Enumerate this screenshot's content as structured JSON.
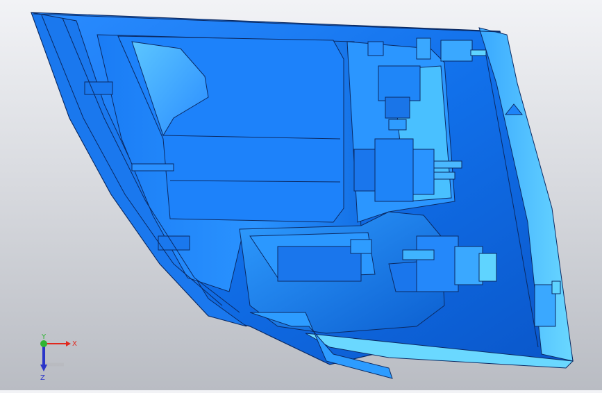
{
  "viewport": {
    "model": "headlamp-assembly"
  },
  "triad": {
    "x_label": "X",
    "y_label": "Y",
    "z_label": "Z",
    "colors": {
      "x": "#e0281e",
      "y": "#2fb533",
      "z": "#2a35c9"
    }
  },
  "colors": {
    "model_dark": "#0b5fd6",
    "model_mid": "#1e88ff",
    "model_light": "#3fb4ff",
    "model_cyan": "#5fd4ff",
    "edge": "#0b2a63",
    "background_top": "#f2f3f6",
    "background_bottom": "#b9bcc3"
  }
}
